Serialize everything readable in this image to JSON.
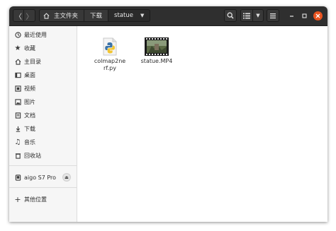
{
  "nav": {
    "back": "〈",
    "forward": "〉"
  },
  "path": {
    "segments": [
      "主文件夹",
      "下载",
      "statue"
    ]
  },
  "sidebar": {
    "items": [
      {
        "icon": "clock-icon",
        "label": "最近使用"
      },
      {
        "icon": "star-icon",
        "label": "收藏"
      },
      {
        "icon": "home-icon",
        "label": "主目录"
      },
      {
        "icon": "desktop-icon",
        "label": "桌面"
      },
      {
        "icon": "video-icon",
        "label": "视频"
      },
      {
        "icon": "picture-icon",
        "label": "图片"
      },
      {
        "icon": "document-icon",
        "label": "文档"
      },
      {
        "icon": "download-icon",
        "label": "下载"
      },
      {
        "icon": "music-icon",
        "label": "音乐"
      },
      {
        "icon": "trash-icon",
        "label": "回收站"
      }
    ],
    "device": {
      "icon": "drive-icon",
      "label": "aigo S7 Pro"
    },
    "other": {
      "icon": "plus-icon",
      "label": "其他位置"
    }
  },
  "files": [
    {
      "name": "colmap2nerf.py",
      "line1": "colmap2ne",
      "line2": "rf.py",
      "icon": "python-file-icon"
    },
    {
      "name": "statue.MP4",
      "icon": "video-file-icon"
    }
  ],
  "colors": {
    "headerbar": "#2f2f2f",
    "sidebar": "#f6f6f6",
    "accent": "#e95420"
  }
}
